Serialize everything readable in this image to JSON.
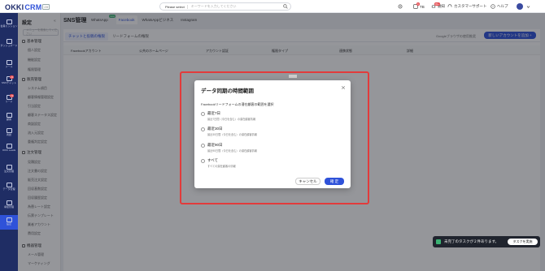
{
  "app": {
    "brand": "OKKI",
    "brand_suffix": "CRM",
    "version": "20"
  },
  "header": {
    "search_select": "Please select",
    "search_placeholder": "キーワードを入力してください",
    "tb_label": "TB",
    "tb_badge": "9",
    "notice_label": "通知",
    "notice_badge": "99+",
    "support_label": "カスタマーサポート",
    "help_label": "ヘルプ"
  },
  "left_nav": [
    {
      "label": "会員ミッション"
    },
    {
      "label": "ダッシュボード"
    },
    {
      "label": "メール"
    },
    {
      "label": "SNSチャット",
      "badge": "21"
    },
    {
      "label": "リード",
      "badge": "19"
    },
    {
      "label": "顧客"
    },
    {
      "label": "商談"
    },
    {
      "label": "OKKI Leads"
    },
    {
      "label": "注文管理"
    },
    {
      "label": "データ管理"
    },
    {
      "label": "承認管理"
    },
    {
      "label": "設定"
    }
  ],
  "sidebar": {
    "title": "設定",
    "collapse": "«",
    "search_placeholder": "メニューを検索してください",
    "groups": [
      {
        "label": "基本管理",
        "items": [
          "個人設定",
          "機能設定",
          "権限管理"
        ]
      },
      {
        "label": "販売管理",
        "items": [
          "システム項目",
          "顧客情報管理設定",
          "引当設定",
          "顧客ステータス設定",
          "商談設定",
          "流入元設定",
          "重複判定設定"
        ]
      },
      {
        "label": "注文管理",
        "items": [
          "見積設定",
          "注文書の設定",
          "販売注文設定",
          "回収基数設定",
          "回収履歴設定",
          "為替レート設定",
          "伝票テンプレート",
          "業者アカウント",
          "費用設定"
        ]
      },
      {
        "label": "機器管理",
        "items": [
          "メール管理",
          "マーケティング"
        ]
      }
    ]
  },
  "page": {
    "title": "SNS管理",
    "tabs": [
      {
        "label": "WhatsApp",
        "new": "new"
      },
      {
        "label": "Facebook"
      },
      {
        "label": "WhatsAppビジネス"
      },
      {
        "label": "Instagram"
      }
    ],
    "subtabs": [
      "チャットと投稿の権限",
      "リードフォームの権限"
    ],
    "hint": "Googleブラウザの使用推奨",
    "add_button": "新しいアカウントを追加 +",
    "columns": [
      "Facebookアカウント",
      "公共のホームページ",
      "アカウント認証",
      "権限タイプ",
      "連携状態",
      "詳細"
    ]
  },
  "modal": {
    "title": "データ同期の時間範囲",
    "description": "Facebookリードフォームの潜在顧客の範囲を選択",
    "options": [
      {
        "label": "最近7日",
        "sub": "最近7日間（今日を含む）の潜在顧客情報"
      },
      {
        "label": "最近30日",
        "sub": "最近30日間（今日を含む）の潜在顧客情報"
      },
      {
        "label": "最近90日",
        "sub": "最近90日間（今日を含む）の潜在顧客情報"
      },
      {
        "label": "すべて",
        "sub": "すべての潜在顧客の情報"
      }
    ],
    "cancel": "キャンセル",
    "ok": "確 定"
  },
  "toast": {
    "text": "未完了のタスクが２件あります。",
    "button": "タスクを実施"
  }
}
